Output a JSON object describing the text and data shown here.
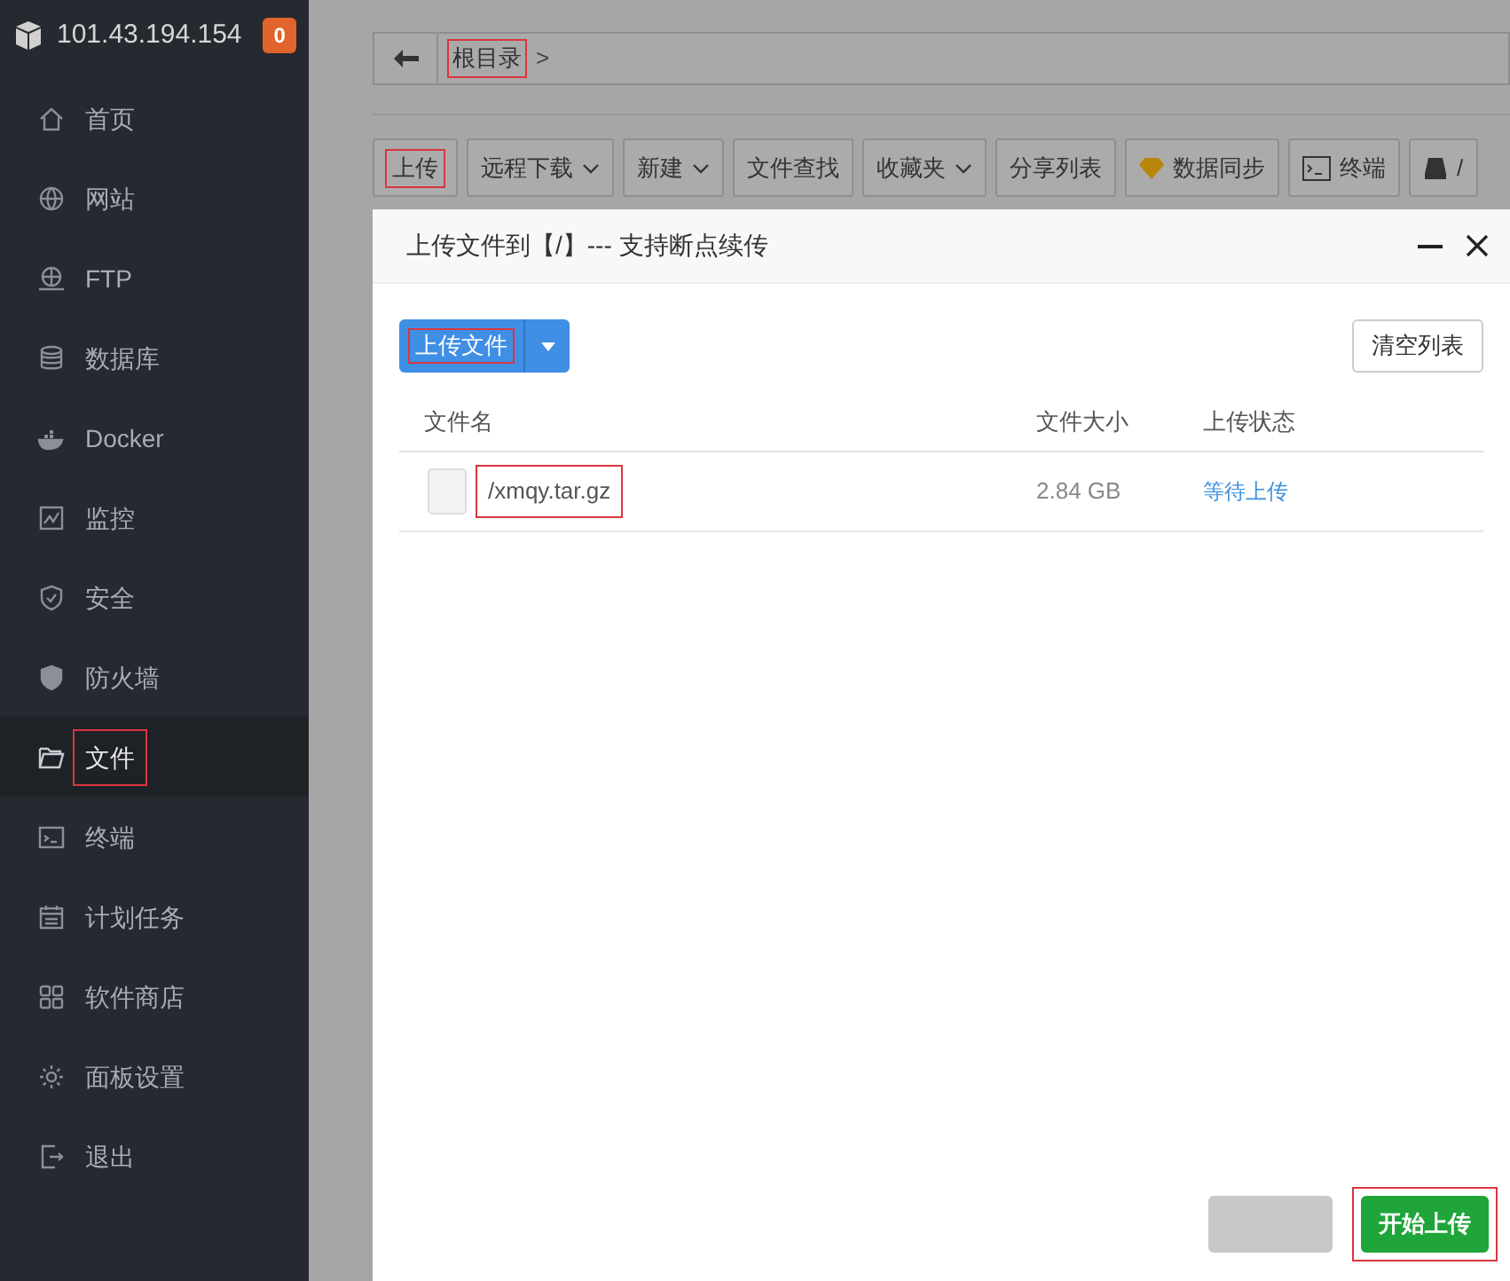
{
  "sidebar": {
    "host": "101.43.194.154",
    "badge": "0",
    "items": [
      {
        "kind": "home",
        "label": "首页",
        "selected": false,
        "annotated": false
      },
      {
        "kind": "globe",
        "label": "网站",
        "selected": false,
        "annotated": false
      },
      {
        "kind": "ftp",
        "label": "FTP",
        "selected": false,
        "annotated": false
      },
      {
        "kind": "database",
        "label": "数据库",
        "selected": false,
        "annotated": false
      },
      {
        "kind": "docker",
        "label": "Docker",
        "selected": false,
        "annotated": false
      },
      {
        "kind": "monitor",
        "label": "监控",
        "selected": false,
        "annotated": false
      },
      {
        "kind": "shield",
        "label": "安全",
        "selected": false,
        "annotated": false
      },
      {
        "kind": "firewall",
        "label": "防火墙",
        "selected": false,
        "annotated": false
      },
      {
        "kind": "folder",
        "label": "文件",
        "selected": true,
        "annotated": true
      },
      {
        "kind": "terminal",
        "label": "终端",
        "selected": false,
        "annotated": false
      },
      {
        "kind": "calendar",
        "label": "计划任务",
        "selected": false,
        "annotated": false
      },
      {
        "kind": "apps",
        "label": "软件商店",
        "selected": false,
        "annotated": false
      },
      {
        "kind": "gear",
        "label": "面板设置",
        "selected": false,
        "annotated": false
      },
      {
        "kind": "logout",
        "label": "退出",
        "selected": false,
        "annotated": false
      }
    ]
  },
  "breadcrumb": {
    "items": [
      {
        "label": "根目录",
        "annotated": true
      }
    ],
    "separator": ">"
  },
  "toolbar": [
    {
      "kind": "plain",
      "label": "上传",
      "annotated": true
    },
    {
      "kind": "dropdown",
      "label": "远程下载",
      "annotated": false
    },
    {
      "kind": "dropdown",
      "label": "新建",
      "annotated": false
    },
    {
      "kind": "plain",
      "label": "文件查找",
      "annotated": false
    },
    {
      "kind": "dropdown",
      "label": "收藏夹",
      "annotated": false
    },
    {
      "kind": "plain",
      "label": "分享列表",
      "annotated": false
    },
    {
      "kind": "sync",
      "label": "数据同步",
      "annotated": false
    },
    {
      "kind": "terminal",
      "label": "终端",
      "annotated": false
    },
    {
      "kind": "disk",
      "label": "/",
      "annotated": false
    }
  ],
  "dialog": {
    "title": "上传文件到【/】--- 支持断点续传",
    "upload_button": {
      "label": "上传文件",
      "annotated": true
    },
    "clear_button": "清空列表",
    "table": {
      "columns": [
        "文件名",
        "文件大小",
        "上传状态"
      ],
      "rows": [
        {
          "name": "/xmqy.tar.gz",
          "size": "2.84 GB",
          "status": "等待上传",
          "annotated": true
        }
      ]
    },
    "start_button": {
      "label": "开始上传",
      "annotated": true
    }
  }
}
